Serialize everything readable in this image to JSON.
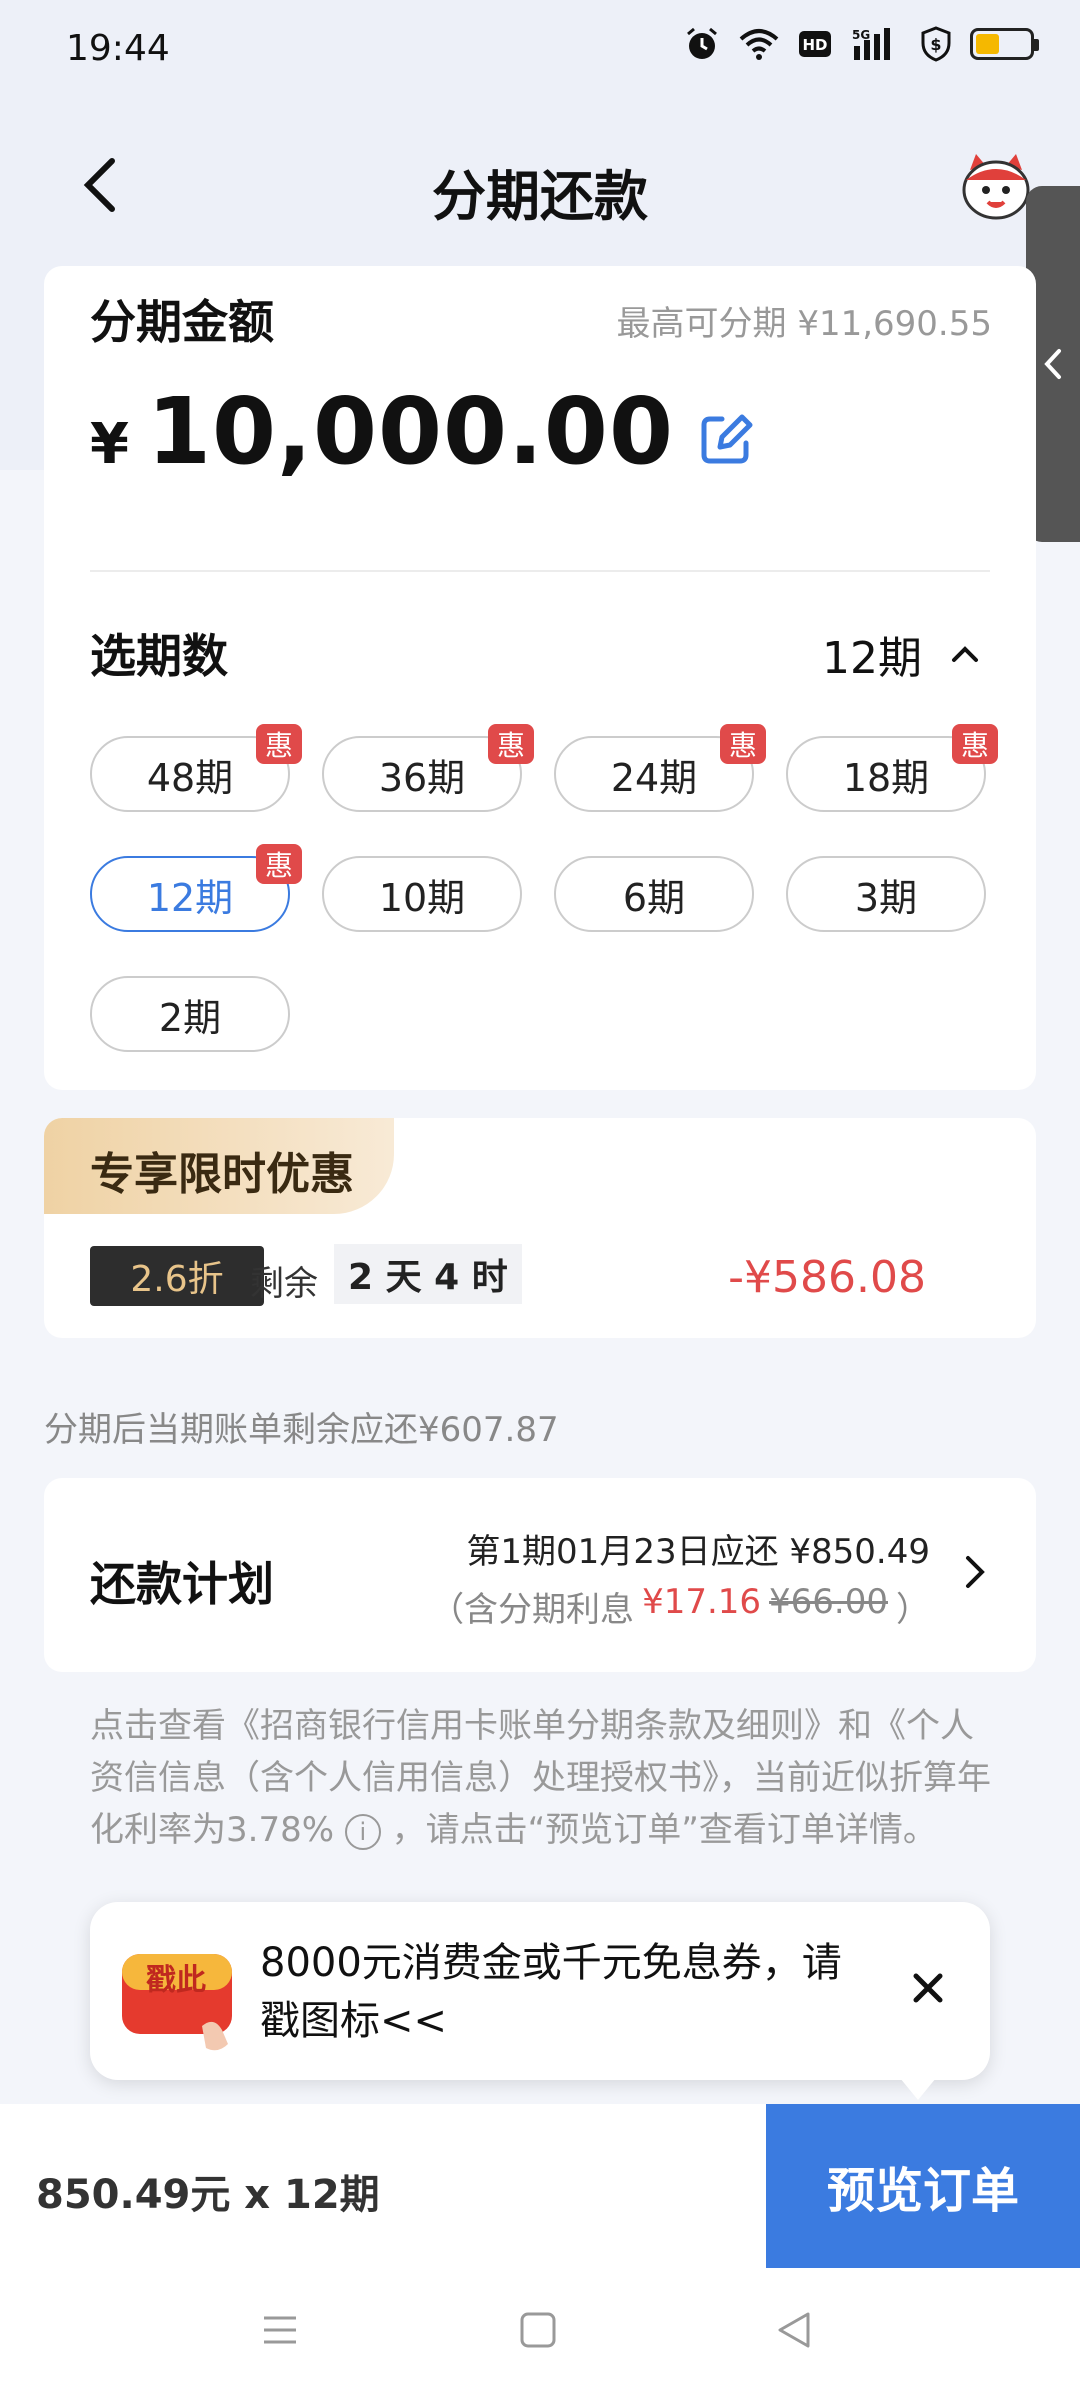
{
  "status": {
    "time": "19:44",
    "network": "5G",
    "hd": "HD"
  },
  "nav": {
    "title": "分期还款"
  },
  "amount_section": {
    "label": "分期金额",
    "max_label": "最高可分期 ¥11,690.55",
    "currency": "¥",
    "amount": "10,000.00"
  },
  "period_section": {
    "label": "选期数",
    "selected": "12期",
    "options": [
      {
        "label": "48期",
        "badge": "惠"
      },
      {
        "label": "36期",
        "badge": "惠"
      },
      {
        "label": "24期",
        "badge": "惠"
      },
      {
        "label": "18期",
        "badge": "惠"
      },
      {
        "label": "12期",
        "badge": "惠"
      },
      {
        "label": "10期"
      },
      {
        "label": "6期"
      },
      {
        "label": "3期"
      },
      {
        "label": "2期"
      }
    ]
  },
  "promo": {
    "title": "专享限时优惠",
    "discount": "2.6折",
    "remain_label": "剩余",
    "remain_time": "2 天 4 时",
    "amount": "-¥586.08"
  },
  "remaining_text": "分期后当期账单剩余应还¥607.87",
  "plan": {
    "label": "还款计划",
    "line1": "第1期01月23日应还 ¥850.49",
    "line2_prefix": "（含分期利息",
    "interest": "¥17.16",
    "original_interest": "¥66.00",
    "line2_suffix": "）"
  },
  "terms": {
    "text": "点击查看《招商银行信用卡账单分期条款及细则》和《个人资信信息（含个人信用信息）处理授权书》，当前近似折算年化利率为3.78%",
    "info": "i",
    "text2": "，请点击“预览订单”查看订单详情。"
  },
  "popup": {
    "icon_text": "戳此",
    "text": "8000元消费金或千元免息券，请戳图标<<"
  },
  "bottom": {
    "summary": "850.49元 x 12期",
    "button": "预览订单"
  },
  "colors": {
    "accent": "#3b7be0",
    "red": "#e04a4a",
    "badge_red": "#e04a4a"
  }
}
